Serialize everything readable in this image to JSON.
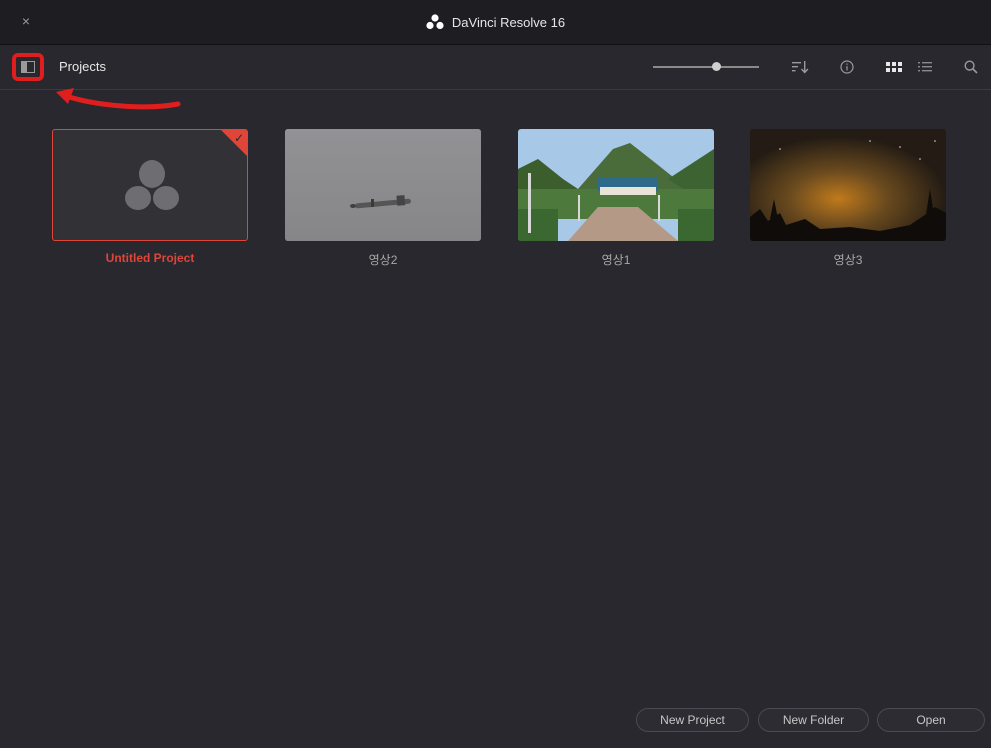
{
  "window": {
    "title": "DaVinci Resolve 16",
    "close_glyph": "×"
  },
  "toolbar": {
    "section_label": "Projects",
    "icons": [
      "sidebar-toggle-icon",
      "sort-icon",
      "info-icon",
      "grid-view-icon",
      "list-view-icon",
      "search-icon"
    ],
    "thumbnail_zoom_fraction": 0.6
  },
  "projects": [
    {
      "name": "Untitled Project",
      "selected": true
    },
    {
      "name": "영상2",
      "selected": false
    },
    {
      "name": "영상1",
      "selected": false
    },
    {
      "name": "영상3",
      "selected": false
    }
  ],
  "footer": {
    "new_project": "New Project",
    "new_folder": "New Folder",
    "open": "Open"
  },
  "colors": {
    "accent": "#e0453a",
    "annotation": "#e01e1e",
    "background": "#28282e"
  }
}
